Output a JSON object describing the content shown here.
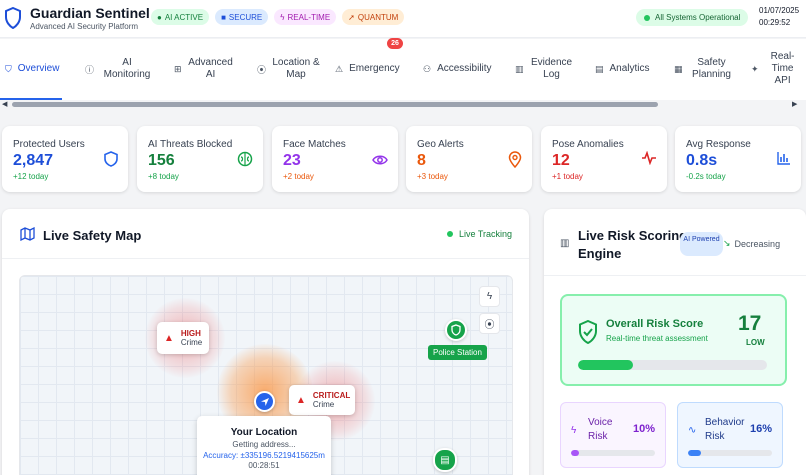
{
  "header": {
    "title": "Guardian Sentinel",
    "subtitle": "Advanced AI Security Platform",
    "badges": [
      {
        "label": "AI ACTIVE",
        "icon": "brain-icon"
      },
      {
        "label": "SECURE",
        "icon": "lock-icon"
      },
      {
        "label": "REAL-TIME",
        "icon": "lightning-icon"
      },
      {
        "label": "QUANTUM",
        "icon": "rocket-icon"
      }
    ],
    "system_status": "All Systems Operational",
    "date": "01/07/2025",
    "time": "00:29:52"
  },
  "tabs": [
    {
      "label": "Overview",
      "icon": "shield-icon",
      "active": true
    },
    {
      "label": "AI Monitoring",
      "icon": "info-icon"
    },
    {
      "label": "Advanced AI",
      "icon": "grid-icon"
    },
    {
      "label": "Location & Map",
      "icon": "pin-icon"
    },
    {
      "label": "Emergency",
      "icon": "warning-icon",
      "badge": "26"
    },
    {
      "label": "Accessibility",
      "icon": "users-icon"
    },
    {
      "label": "Evidence Log",
      "icon": "bar-chart-icon"
    },
    {
      "label": "Analytics",
      "icon": "document-icon"
    },
    {
      "label": "Safety Planning",
      "icon": "calendar-icon"
    },
    {
      "label": "Real-Time API",
      "icon": "sparkle-icon"
    }
  ],
  "stats": [
    {
      "title": "Protected Users",
      "value": "2,847",
      "sub": "+12 today",
      "icon": "shield-icon",
      "color": "#1d4ed8",
      "sub_color": "#16a34a"
    },
    {
      "title": "AI Threats Blocked",
      "value": "156",
      "sub": "+8 today",
      "icon": "brain-icon",
      "color": "#15803d",
      "sub_color": "#16a34a"
    },
    {
      "title": "Face Matches",
      "value": "23",
      "sub": "+2 today",
      "icon": "eye-icon",
      "color": "#9333ea",
      "sub_color": "#ea580c"
    },
    {
      "title": "Geo Alerts",
      "value": "8",
      "sub": "+3 today",
      "icon": "map-pin-icon",
      "color": "#ea580c",
      "sub_color": "#ea580c"
    },
    {
      "title": "Pose Anomalies",
      "value": "12",
      "sub": "+1 today",
      "icon": "pulse-icon",
      "color": "#dc2626",
      "sub_color": "#dc2626"
    },
    {
      "title": "Avg Response",
      "value": "0.8s",
      "sub": "-0.2s today",
      "icon": "bar-chart-icon",
      "color": "#1d4ed8",
      "sub_color": "#16a34a"
    }
  ],
  "map": {
    "title": "Live Safety Map",
    "tracking": "Live Tracking",
    "alerts": [
      {
        "level": "HIGH",
        "type": "Crime"
      },
      {
        "level": "CRITICAL",
        "type": "Crime"
      }
    ],
    "police_label": "Police Station",
    "popup": {
      "title": "Your Location",
      "address": "Getting address...",
      "accuracy": "Accuracy: ±335196.5219415625m",
      "time": "00:28:51"
    }
  },
  "risk": {
    "title": "Live Risk Scoring Engine",
    "ai_badge": "AI Powered",
    "trend": "Decreasing",
    "overall_title": "Overall Risk Score",
    "overall_sub": "Real-time threat assessment",
    "overall_score": "17",
    "overall_level": "LOW",
    "overall_fill": 0.29,
    "voice": {
      "label": "Voice Risk",
      "value": "10%",
      "fill": 0.1
    },
    "behavior": {
      "label": "Behavior Risk",
      "value": "16%",
      "fill": 0.16
    }
  }
}
